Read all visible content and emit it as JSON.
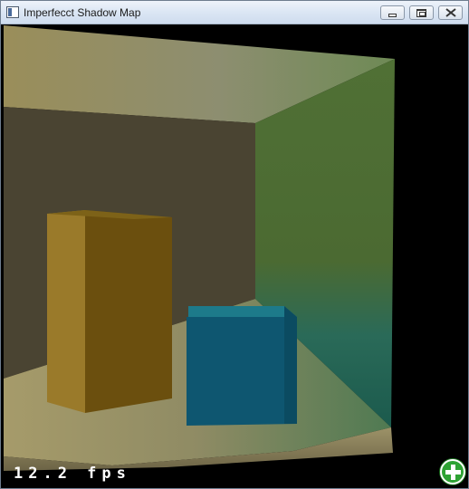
{
  "window": {
    "title": "Imperfecct Shadow Map",
    "controls": {
      "minimize": "minimize",
      "maximize": "maximize",
      "close": "close"
    }
  },
  "overlay": {
    "fps_text": "12.2 fps"
  },
  "icons": {
    "app": "app-window-icon",
    "add": "plus-icon"
  },
  "colors": {
    "background": "#000000",
    "back_wall": "#4a4432",
    "right_wall": "#4a6530",
    "tall_box": "#7a5a14",
    "cube": "#0f5670",
    "floor": "#8e8a62",
    "add_button": "#2ea334"
  }
}
